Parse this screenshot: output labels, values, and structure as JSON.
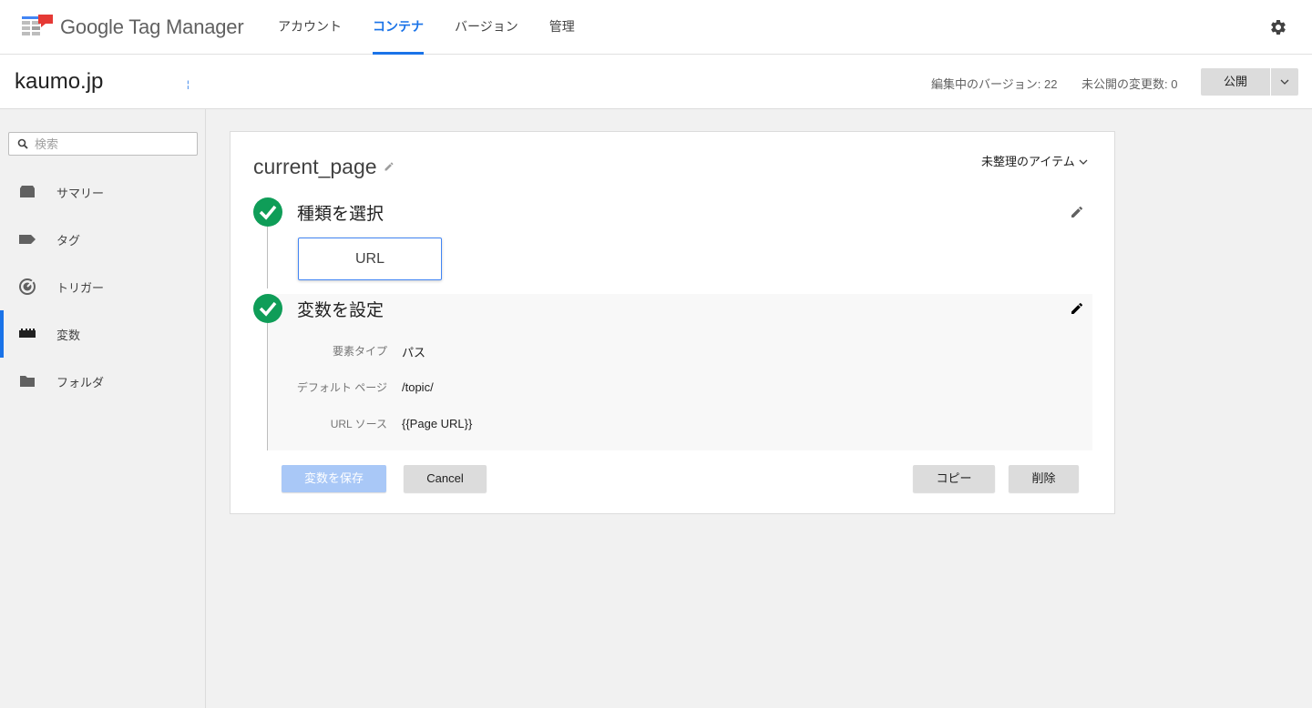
{
  "header": {
    "brand": "Google Tag Manager",
    "nav": [
      {
        "label": "アカウント"
      },
      {
        "label": "コンテナ"
      },
      {
        "label": "バージョン"
      },
      {
        "label": "管理"
      }
    ],
    "active_nav": "コンテナ"
  },
  "subheader": {
    "container_name": "kaumo.jp",
    "workspace_indicator": "¦",
    "editing_version": "編集中のバージョン: 22",
    "unpublished_changes": "未公開の変更数: 0",
    "publish_label": "公開"
  },
  "sidebar": {
    "search_placeholder": "検索",
    "items": [
      {
        "label": "サマリー",
        "icon": "summary-icon"
      },
      {
        "label": "タグ",
        "icon": "tag-icon"
      },
      {
        "label": "トリガー",
        "icon": "trigger-icon"
      },
      {
        "label": "変数",
        "icon": "variable-icon"
      },
      {
        "label": "フォルダ",
        "icon": "folder-icon"
      }
    ],
    "active_item": "変数"
  },
  "editor": {
    "variable_name": "current_page",
    "folder_selector": "未整理のアイテム",
    "step1": {
      "title": "種類を選択",
      "selected_type": "URL"
    },
    "step2": {
      "title": "変数を設定",
      "fields": [
        {
          "label": "要素タイプ",
          "value": "パス"
        },
        {
          "label": "デフォルト ページ",
          "value": "/topic/"
        },
        {
          "label": "URL ソース",
          "value": "{{Page URL}}"
        }
      ]
    },
    "buttons": {
      "save": "変数を保存",
      "cancel": "Cancel",
      "copy": "コピー",
      "delete": "削除"
    }
  },
  "colors": {
    "accent": "#1a73e8",
    "success": "#0f9d58",
    "logo_red": "#e53935",
    "logo_blue": "#4285f4"
  }
}
